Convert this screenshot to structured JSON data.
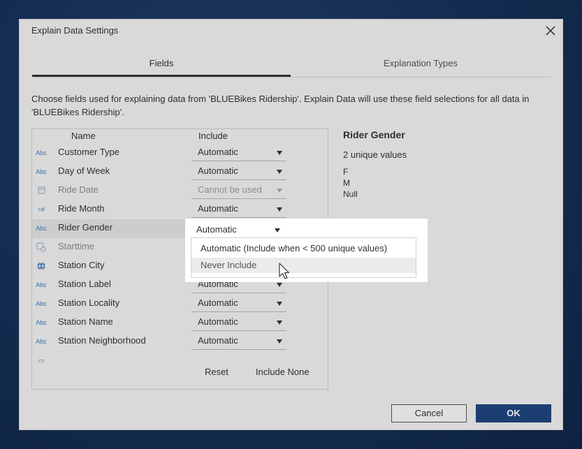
{
  "dialog": {
    "title": "Explain Data Settings",
    "tabs": [
      {
        "label": "Fields",
        "active": true
      },
      {
        "label": "Explanation Types",
        "active": false
      }
    ],
    "description": "Choose fields used for explaining data from 'BLUEBikes Ridership'. Explain Data will use these field selections for all data in 'BLUEBikes Ridership'.",
    "columns": {
      "name": "Name",
      "include": "Include"
    },
    "fields": [
      {
        "icon": "Abc",
        "name": "Customer Type",
        "include": "Automatic",
        "disabled": false
      },
      {
        "icon": "Abc",
        "name": "Day of Week",
        "include": "Automatic",
        "disabled": false
      },
      {
        "icon": "calendar-icon",
        "name": "Ride Date",
        "include": "Cannot be used",
        "disabled": true
      },
      {
        "icon": "=#",
        "name": "Ride Month",
        "include": "Automatic",
        "disabled": false
      },
      {
        "icon": "Abc",
        "name": "Rider Gender",
        "include": "Automatic",
        "disabled": false,
        "selected": true
      },
      {
        "icon": "calendar-clock-icon",
        "name": "Starttime",
        "include": "",
        "disabled": true
      },
      {
        "icon": "globe-icon",
        "name": "Station City",
        "include": "",
        "disabled": false
      },
      {
        "icon": "Abc",
        "name": "Station Label",
        "include": "Automatic",
        "disabled": false
      },
      {
        "icon": "Abc",
        "name": "Station Locality",
        "include": "Automatic",
        "disabled": false
      },
      {
        "icon": "Abc",
        "name": "Station Name",
        "include": "Automatic",
        "disabled": false
      },
      {
        "icon": "Abc",
        "name": "Station Neighborhood",
        "include": "Automatic",
        "disabled": false
      }
    ],
    "footer_links": {
      "reset": "Reset",
      "include_none": "Include None"
    },
    "details": {
      "title": "Rider Gender",
      "count": "2 unique values",
      "values": [
        "F",
        "M",
        "Null"
      ]
    },
    "dropdown_menu": {
      "current": "Automatic",
      "options": [
        "Automatic (Include when < 500 unique values)",
        "Never Include"
      ],
      "hovered": "Never Include"
    },
    "buttons": {
      "cancel": "Cancel",
      "ok": "OK"
    }
  },
  "colors": {
    "ok_button": "#1f457e",
    "field_icon": "#3e78b2",
    "backdrop": "#142c50"
  }
}
